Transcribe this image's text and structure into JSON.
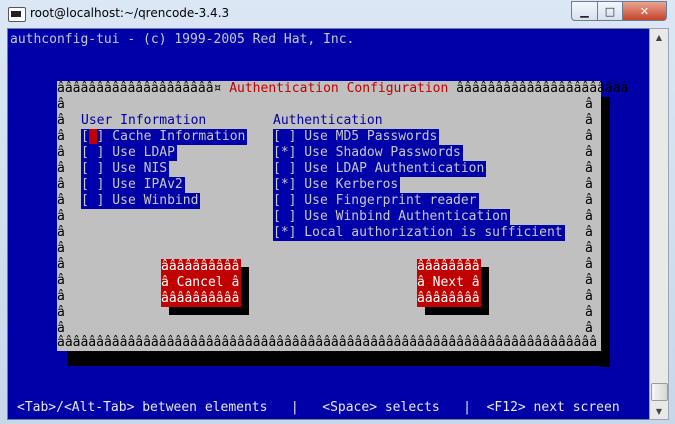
{
  "window": {
    "title": "root@localhost:~/qrencode-3.4.3",
    "minimize_icon": "minimize-icon",
    "maximize_icon": "maximize-icon",
    "close_icon": "close-icon",
    "minimize_glyph": "▁",
    "maximize_glyph": "□",
    "close_glyph": "✕"
  },
  "terminal": {
    "header": "authconfig-tui - (c) 1999-2005 Red Hat, Inc.",
    "status_line": "<Tab>/<Alt-Tab> between elements   |   <Space> selects   |  <F12> next screen"
  },
  "dialog": {
    "title_left": "ââââââââââââââââââââ¤ ",
    "title": "Authentication Configuration",
    "title_right": " ââââââââââââââââââââââ",
    "left_border": "â\nâ\nâ\nâ\nâ\nâ\nâ\nâ\nâ\nâ\nâ\nâ\nâ\nâ\nâ",
    "right_border": "â\nâ\nâ\nâ\nâ\nâ\nâ\nâ\nâ\nâ\nâ\nâ\nâ\nâ\nâ",
    "bottom_border": "âââââââââââââââââââââââââââââââââââââââââââââââââââââââââââââââââââââ",
    "user_info_heading": "User Information",
    "auth_heading": "Authentication",
    "user_info_items": [
      {
        "box": "[ ]",
        "label": " Cache Information"
      },
      {
        "box": "[ ]",
        "label": " Use LDAP"
      },
      {
        "box": "[ ]",
        "label": " Use NIS"
      },
      {
        "box": "[ ]",
        "label": " Use IPAv2"
      },
      {
        "box": "[ ]",
        "label": " Use Winbind"
      }
    ],
    "auth_items": [
      {
        "box": "[ ]",
        "label": " Use MD5 Passwords"
      },
      {
        "box": "[*]",
        "label": " Use Shadow Passwords"
      },
      {
        "box": "[ ]",
        "label": " Use LDAP Authentication"
      },
      {
        "box": "[*]",
        "label": " Use Kerberos"
      },
      {
        "box": "[ ]",
        "label": " Use Fingerprint reader"
      },
      {
        "box": "[ ]",
        "label": " Use Winbind Authentication"
      },
      {
        "box": "[*]",
        "label": " Local authorization is sufficient"
      }
    ],
    "cancel_button": {
      "top": "ââââââââââ",
      "label": "â Cancel â",
      "bottom": "ââââââââââ"
    },
    "next_button": {
      "top": "ââââââââ",
      "label": "â Next â",
      "bottom": "ââââââââ"
    }
  }
}
